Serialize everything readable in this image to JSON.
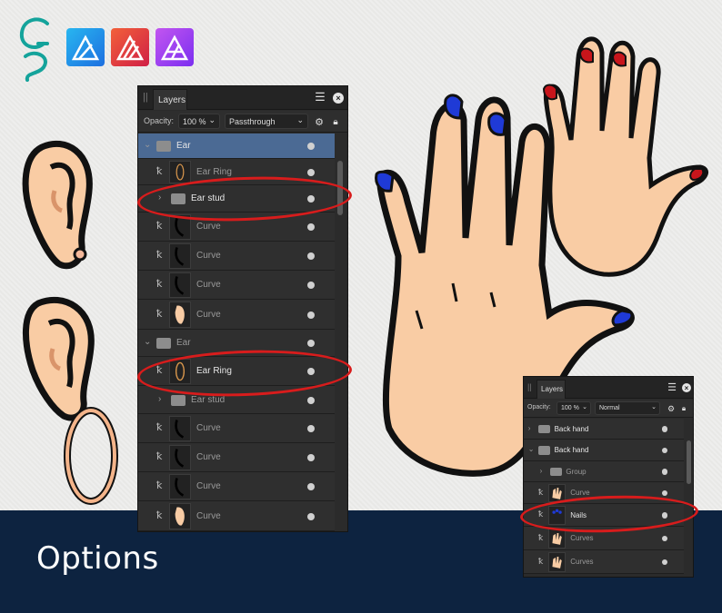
{
  "branding": {
    "logo": "GS",
    "apps": [
      "designer-icon",
      "publisher-icon",
      "photo-icon"
    ]
  },
  "footer": {
    "label": "Options"
  },
  "panel_left": {
    "tab": "Layers",
    "opacity_label": "Opacity:",
    "opacity_value": "100 %",
    "blend_mode": "Passthrough",
    "layers": [
      {
        "name": "Ear"
      },
      {
        "name": "Ear Ring"
      },
      {
        "name": "Ear stud"
      },
      {
        "name": "Curve"
      },
      {
        "name": "Curve"
      },
      {
        "name": "Curve"
      },
      {
        "name": "Curve"
      },
      {
        "name": "Ear"
      },
      {
        "name": "Ear Ring"
      },
      {
        "name": "Ear stud"
      },
      {
        "name": "Curve"
      },
      {
        "name": "Curve"
      },
      {
        "name": "Curve"
      },
      {
        "name": "Curve"
      }
    ]
  },
  "panel_right": {
    "tab": "Layers",
    "opacity_label": "Opacity:",
    "opacity_value": "100 %",
    "blend_mode": "Normal",
    "layers": [
      {
        "name": "Back hand"
      },
      {
        "name": "Back hand"
      },
      {
        "name": "Group"
      },
      {
        "name": "Curve"
      },
      {
        "name": "Nails"
      },
      {
        "name": "Curves"
      },
      {
        "name": "Curves"
      }
    ]
  },
  "colors": {
    "footer": "#0d2340",
    "highlight": "#d81c1c",
    "selected_row": "#4b6a94",
    "nail_blue": "#1f3ad6",
    "nail_red": "#c8151b",
    "skin": "#f9cca4"
  }
}
